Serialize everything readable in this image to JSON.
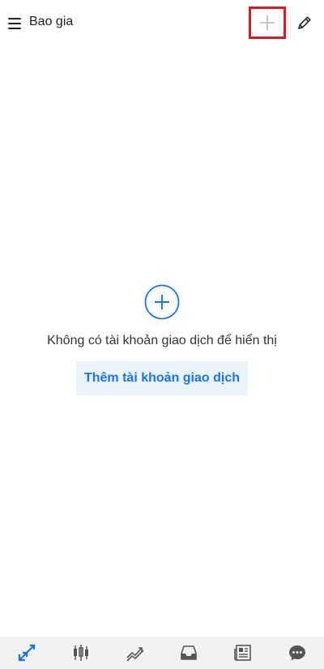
{
  "header": {
    "title": "Bao gia",
    "menu_icon": "hamburger-menu-icon",
    "add_icon": "plus-icon",
    "edit_icon": "pencil-icon",
    "highlight_color": "#e0191f"
  },
  "empty_state": {
    "icon": "circle-plus-icon",
    "message": "Không có tài khoản giao dịch để hiển thị",
    "button_label": "Thêm tài khoản giao dịch",
    "accent_color": "#1a73e8"
  },
  "bottom_nav": {
    "items": [
      {
        "id": "quotes",
        "icon": "quotes-arrows-icon",
        "active": true
      },
      {
        "id": "chart",
        "icon": "candlestick-chart-icon",
        "active": false
      },
      {
        "id": "trade",
        "icon": "trend-lines-icon",
        "active": false
      },
      {
        "id": "history",
        "icon": "inbox-tray-icon",
        "active": false
      },
      {
        "id": "news",
        "icon": "newspaper-icon",
        "active": false
      },
      {
        "id": "messages",
        "icon": "chat-bubble-icon",
        "active": false
      }
    ],
    "active_color": "#1a73e8",
    "inactive_color": "#555555"
  }
}
